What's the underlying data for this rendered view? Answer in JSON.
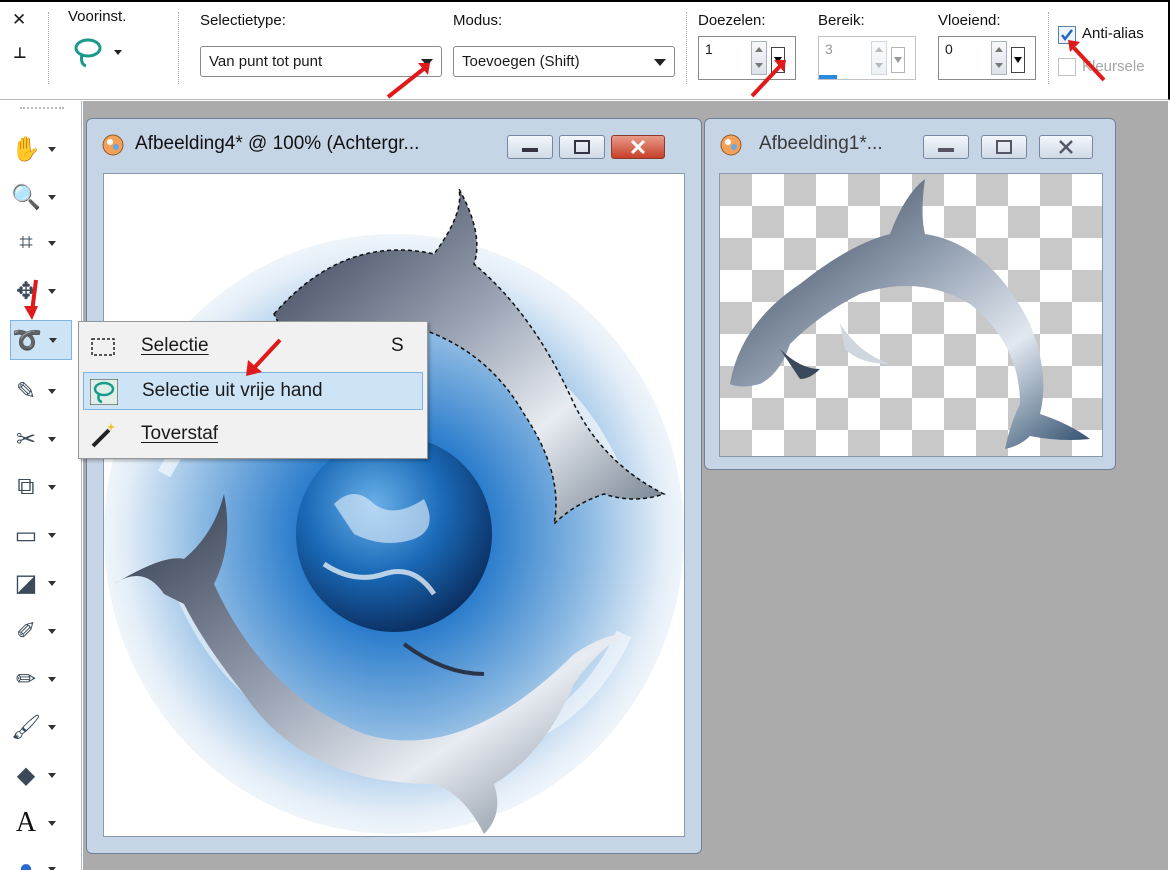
{
  "toolbar": {
    "close_glyph": "✕",
    "pin_glyph": "⊥",
    "presets_label": "Voorinst.",
    "selection_type_label": "Selectietype:",
    "selection_type_value": "Van punt tot punt",
    "mode_label": "Modus:",
    "mode_value": "Toevoegen (Shift)",
    "feather_label": "Doezelen:",
    "feather_value": "1",
    "range_label": "Bereik:",
    "range_value": "3",
    "smoothing_label": "Vloeiend:",
    "smoothing_value": "0",
    "antialias_label": "Anti-alias",
    "antialias_checked": true,
    "color_select_label": "Kleursele"
  },
  "toolbox": {
    "items": [
      {
        "name": "pan-icon",
        "glyph": "✋"
      },
      {
        "name": "zoom-icon",
        "glyph": "🔍"
      },
      {
        "name": "crop-icon",
        "glyph": "⌗"
      },
      {
        "name": "move-icon",
        "glyph": "✥"
      },
      {
        "name": "freehand-selection-icon",
        "glyph": "➰"
      },
      {
        "name": "dropper-icon",
        "glyph": "✎"
      },
      {
        "name": "retouch-icon",
        "glyph": "✂"
      },
      {
        "name": "clone-icon",
        "glyph": "⧉"
      },
      {
        "name": "scratch-remover-icon",
        "glyph": "▭"
      },
      {
        "name": "lighten-darken-icon",
        "glyph": "◪"
      },
      {
        "name": "eraser-icon",
        "glyph": "✐"
      },
      {
        "name": "background-eraser-icon",
        "glyph": "✏"
      },
      {
        "name": "paint-brush-icon",
        "glyph": "🖌"
      },
      {
        "name": "fill-icon",
        "glyph": "◆"
      },
      {
        "name": "text-icon",
        "glyph": "A"
      },
      {
        "name": "shape-icon",
        "glyph": "●"
      }
    ]
  },
  "window1": {
    "title": "Afbeelding4* @ 100% (Achtergr..."
  },
  "window2": {
    "title": "Afbeelding1*..."
  },
  "flyout": {
    "items": [
      {
        "label": "Selectie",
        "shortcut": "S",
        "highlighted": false
      },
      {
        "label": "Selectie uit vrije hand",
        "shortcut": "",
        "highlighted": true
      },
      {
        "label": "Toverstaf",
        "shortcut": "",
        "highlighted": false
      }
    ]
  },
  "colors": {
    "workspace": "#ababab",
    "window_frame": "#c6d5e6",
    "highlight": "#cde3f6",
    "annotation_arrow": "#e0191b"
  }
}
